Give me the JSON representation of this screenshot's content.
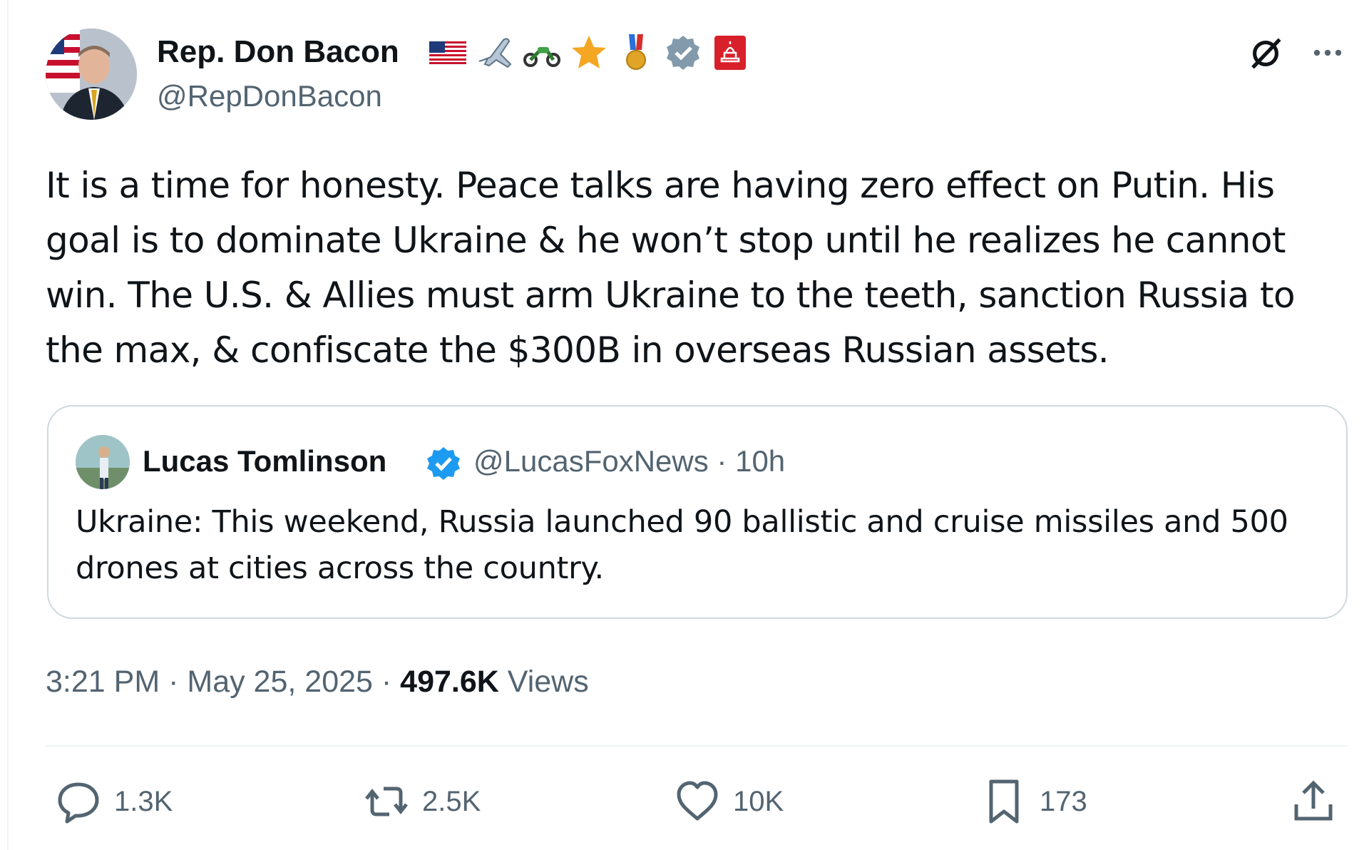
{
  "author": {
    "name": "Rep. Don Bacon",
    "handle": "@RepDonBacon",
    "badges": [
      "us-flag-icon",
      "airplane-icon",
      "motorcycle-icon",
      "star-icon",
      "medal-icon",
      "verified-badge-icon",
      "capitol-icon"
    ]
  },
  "tweet": {
    "text": "It is a time for honesty. Peace talks are having zero effect on Putin. His goal is to dominate Ukraine & he won’t stop until he realizes he cannot win. The U.S. & Allies must arm Ukraine to the teeth, sanction Russia to the max, & confiscate the $300B in overseas Russian assets."
  },
  "quote": {
    "name": "Lucas Tomlinson",
    "handle": "@LucasFoxNews",
    "separator": "·",
    "time": "10h",
    "text": "Ukraine: This weekend, Russia launched 90 ballistic and cruise missiles and 500 drones at cities across the country."
  },
  "meta": {
    "time": "3:21 PM",
    "sep1": "·",
    "date": "May 25, 2025",
    "sep2": "·",
    "views_count": "497.6K",
    "views_label": "Views"
  },
  "actions": {
    "replies": "1.3K",
    "reposts": "2.5K",
    "likes": "10K",
    "bookmarks": "173"
  },
  "colors": {
    "text": "#0f1419",
    "secondary": "#536471",
    "verified": "#1d9bf0",
    "border": "#cfd9de"
  }
}
